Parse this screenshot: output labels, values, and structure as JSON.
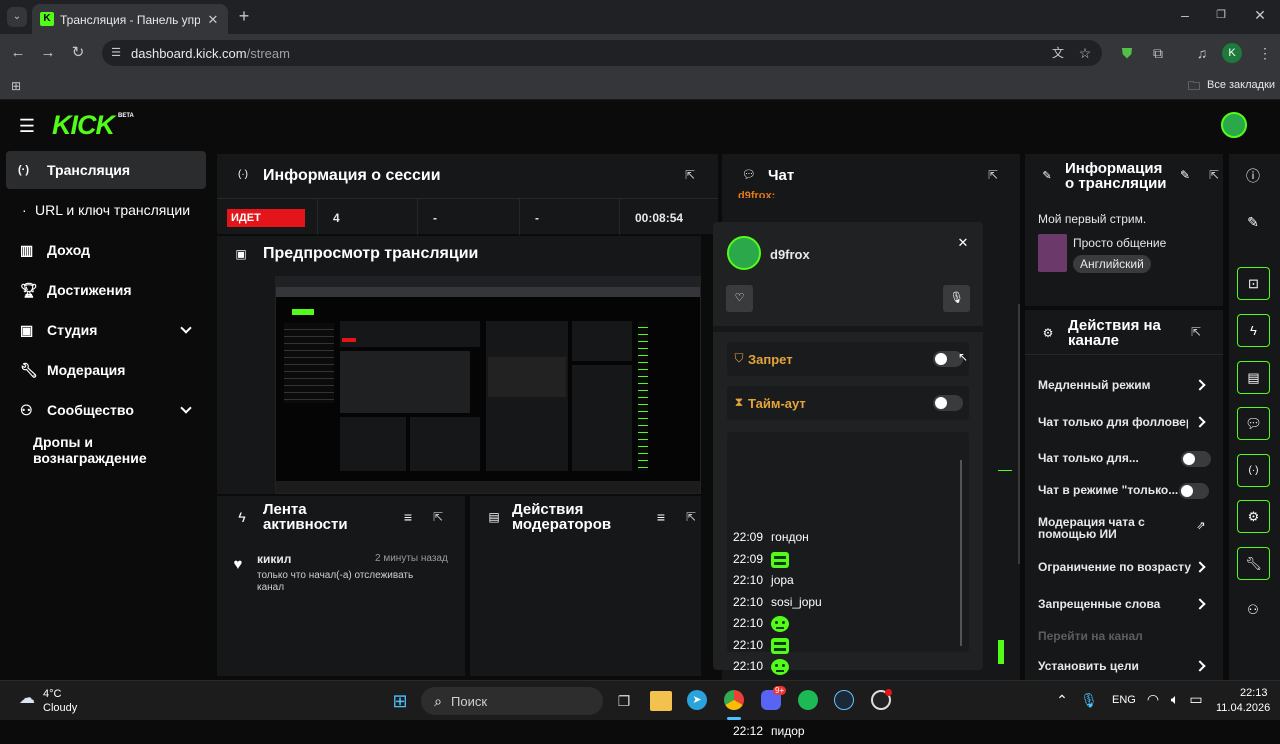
{
  "browser": {
    "tab_title": "Трансляция - Панель управле",
    "url_host": "dashboard.kick.com",
    "url_path": "/stream",
    "bookmarks_label": "Все закладки",
    "profile_letter": "K"
  },
  "header": {
    "logo": "KICK",
    "beta": "BETA"
  },
  "sidebar": {
    "items": [
      {
        "label": "Трансляция"
      },
      {
        "label": "URL и ключ трансляции"
      },
      {
        "label": "Доход"
      },
      {
        "label": "Достижения"
      },
      {
        "label": "Студия"
      },
      {
        "label": "Модерация"
      },
      {
        "label": "Сообщество"
      },
      {
        "label": "Дропы и вознаграждение"
      }
    ]
  },
  "session": {
    "title": "Информация о сессии",
    "status": "ИДЕТ",
    "viewers": "4",
    "stat2": "-",
    "stat3": "-",
    "duration": "00:08:54"
  },
  "preview": {
    "title": "Предпросмотр трансляции"
  },
  "activity": {
    "title_line1": "Лента",
    "title_line2": "активности",
    "item_user": "кикил",
    "item_time": "2 минуты назад",
    "item_text_line1": "только что начал(-а) отслеживать",
    "item_text_line2": "канал"
  },
  "modactions": {
    "title_line1": "Действия",
    "title_line2": "модераторов"
  },
  "chat": {
    "title": "Чат",
    "partial_user": "d9frox:",
    "popup": {
      "username": "d9frox",
      "ban_label": "Запрет",
      "timeout_label": "Тайм-аут"
    },
    "messages": [
      {
        "time": "22:09",
        "text": "гондон",
        "emote": ""
      },
      {
        "time": "22:09",
        "text": "",
        "emote": "block"
      },
      {
        "time": "22:10",
        "text": "jopa",
        "emote": ""
      },
      {
        "time": "22:10",
        "text": "sosi_jopu",
        "emote": ""
      },
      {
        "time": "22:10",
        "text": "",
        "emote": "face"
      },
      {
        "time": "22:10",
        "text": "",
        "emote": "block"
      },
      {
        "time": "22:10",
        "text": "",
        "emote": "face"
      },
      {
        "time": "22:10",
        "text": "",
        "emote": "block"
      },
      {
        "time": "22:10",
        "text": "",
        "emote": "face"
      },
      {
        "time": "22:12",
        "text": "пидор",
        "emote": ""
      }
    ]
  },
  "stream_info": {
    "title_line1": "Информация",
    "title_line2": "о трансляции",
    "stream_title": "Мой первый стрим.",
    "category": "Просто общение",
    "language": "Английский"
  },
  "channel_actions": {
    "title_line1": "Действия на",
    "title_line2": "канале",
    "items": [
      {
        "label": "Медленный режим"
      },
      {
        "label": "Чат только для фолловерс"
      },
      {
        "label": "Чат только для..."
      },
      {
        "label": "Чат в режиме \"только..."
      },
      {
        "label_line1": "Модерация чата с",
        "label_line2": "помощью ИИ"
      },
      {
        "label": "Ограничение по возрасту"
      },
      {
        "label": "Запрещенные слова"
      },
      {
        "label": "Перейти на канал"
      },
      {
        "label": "Установить цели"
      }
    ]
  },
  "taskbar": {
    "weather_temp": "4°C",
    "weather_desc": "Cloudy",
    "search_label": "Поиск",
    "lang": "ENG",
    "time": "22:13",
    "date": "11.04.2026",
    "discord_badge": "9+"
  },
  "colors": {
    "accent": "#53fc18",
    "live_red": "#e3151a",
    "panel": "#161718"
  }
}
